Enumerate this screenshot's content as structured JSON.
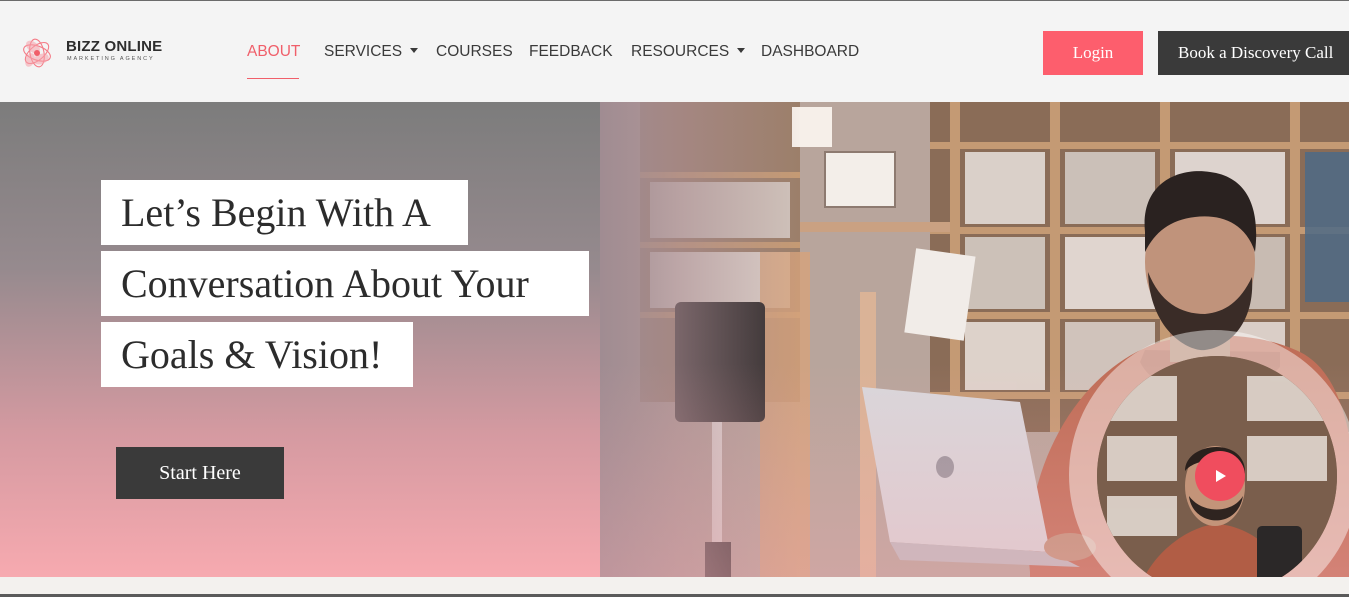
{
  "brand": {
    "name": "BIZZ ONLINE",
    "tagline": "MARKETING AGENCY",
    "logo_icon": "flower-logo-icon",
    "accent_color": "#fd5e6d"
  },
  "nav": {
    "items": [
      {
        "label": "ABOUT",
        "active": true
      },
      {
        "label": "SERVICES",
        "dropdown": true
      },
      {
        "label": "COURSES"
      },
      {
        "label": "FEEDBACK"
      },
      {
        "label": "RESOURCES",
        "dropdown": true
      },
      {
        "label": "DASHBOARD"
      }
    ],
    "dropdown_icon": "caret-down-icon"
  },
  "header": {
    "login_label": "Login",
    "discovery_label": "Book a Discovery Call"
  },
  "hero": {
    "headline_lines": [
      "Let’s Begin With A",
      "Conversation About Your",
      "Goals & Vision!"
    ],
    "cta_label": "Start Here",
    "video_icon": "play-icon",
    "dark_button_color": "#3a3a3a"
  }
}
